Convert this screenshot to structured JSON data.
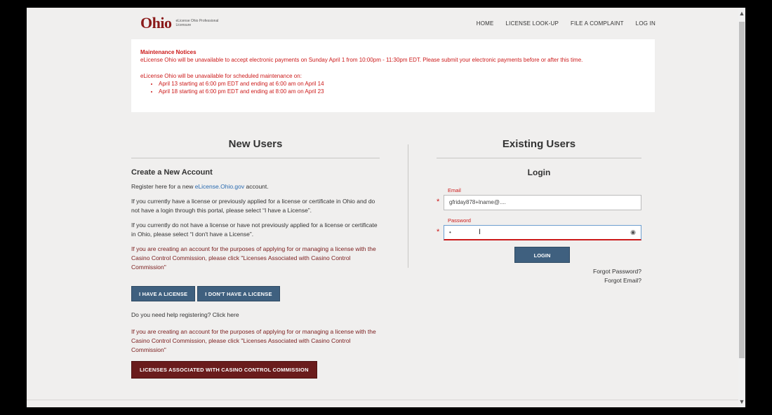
{
  "header": {
    "logo": "Ohio",
    "logo_sub": "eLicense Ohio Professional Licensure",
    "nav": [
      "HOME",
      "LICENSE LOOK-UP",
      "FILE A COMPLAINT",
      "LOG IN"
    ]
  },
  "notice": {
    "title": "Maintenance Notices",
    "line1": "eLicense Ohio will be unavailable to accept electronic payments on Sunday April 1 from 10:00pm - 11:30pm EDT. Please submit your electronic payments before or after this time.",
    "line2": "eLicense Ohio will be unavailable for scheduled maintenance on:",
    "items": [
      "April 13 starting at 6:00 pm EDT and ending at 6:00 am on April 14",
      "April 18 starting at 6:00 pm EDT and ending at 8:00 am on April 23"
    ]
  },
  "new_users": {
    "heading": "New Users",
    "create_title": "Create a New Account",
    "register_pre": "Register here for a new ",
    "register_link": "eLicense.Ohio.gov",
    "register_post": " account.",
    "p_have": "If you currently have a license or previously applied for a license or certificate in Ohio and do not have a login through this portal, please select “I have a License”.",
    "p_dont": "If you currently do not have a license or have not previously applied for a license or certificate in Ohio, please select “I don't have a License”.",
    "p_casino": "If you are creating an account for the purposes of applying for or managing a license with the Casino Control Commission, please click \"Licenses Associated with Casino Control Commission\"",
    "btn_have": "I HAVE A LICENSE",
    "btn_dont": "I DON'T HAVE A LICENSE",
    "help": "Do you need help registering? Click here",
    "p_casino2": "If you are creating an account for the purposes of applying for or managing a license with the Casino Control Commission, please click \"Licenses Associated with Casino Control Commission\"",
    "btn_casino": "LICENSES ASSOCIATED WITH CASINO CONTROL COMMISSION"
  },
  "existing_users": {
    "heading": "Existing Users",
    "login_heading": "Login",
    "email_label": "Email",
    "email_value": "gfriday878+lname@....",
    "password_label": "Password",
    "password_value": "•",
    "login_btn": "LOGIN",
    "forgot_password": "Forgot Password?",
    "forgot_email": "Forgot Email?"
  },
  "colors": {
    "brand": "#8a1a1a",
    "notice_red": "#cc1a1a",
    "button_blue": "#3f607f",
    "casino_button": "#6a1c1c"
  }
}
